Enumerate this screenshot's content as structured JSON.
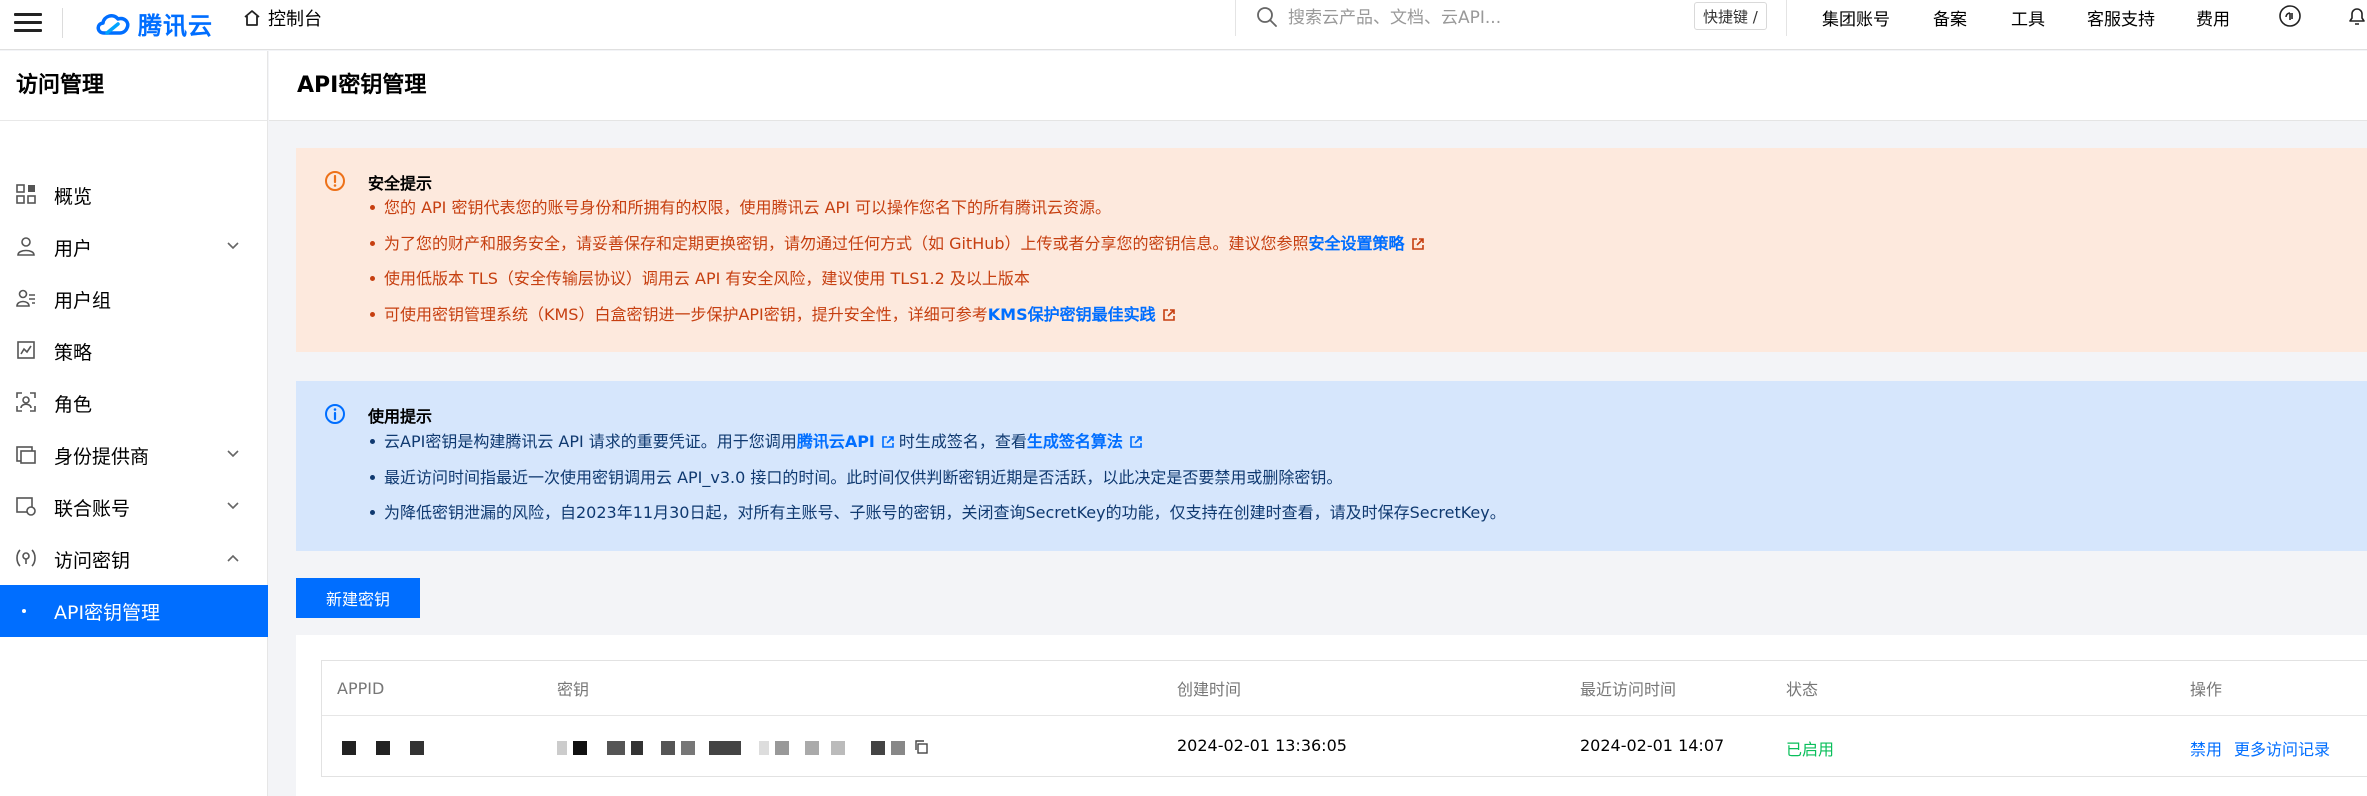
{
  "topbar": {
    "brand": "腾讯云",
    "console": "控制台",
    "search_placeholder": "搜索云产品、文档、云API...",
    "shortcut": "快捷键 /",
    "nav": [
      "集团账号",
      "备案",
      "工具",
      "客服支持",
      "费用"
    ]
  },
  "sidebar": {
    "title": "访问管理",
    "items": [
      {
        "label": "概览",
        "icon": "overview-icon"
      },
      {
        "label": "用户",
        "icon": "user-icon"
      },
      {
        "label": "用户组",
        "icon": "user-group-icon"
      },
      {
        "label": "策略",
        "icon": "policy-icon"
      },
      {
        "label": "角色",
        "icon": "role-icon"
      },
      {
        "label": "身份提供商",
        "icon": "identity-provider-icon"
      },
      {
        "label": "联合账号",
        "icon": "federated-account-icon"
      },
      {
        "label": "访问密钥",
        "icon": "access-key-icon"
      },
      {
        "label": "API密钥管理",
        "icon": "dot"
      }
    ]
  },
  "main": {
    "title": "API密钥管理",
    "security_notice": {
      "title": "安全提示",
      "lines": [
        "您的 API 密钥代表您的账号身份和所拥有的权限，使用腾讯云 API 可以操作您名下的所有腾讯云资源。",
        "为了您的财产和服务安全，请妥善保存和定期更换密钥，请勿通过任何方式（如 GitHub）上传或者分享您的密钥信息。建议您参照",
        "使用低版本 TLS（安全传输层协议）调用云 API 有安全风险，建议使用 TLS1.2 及以上版本",
        "可使用密钥管理系统（KMS）白盒密钥进一步保护API密钥，提升安全性，详细可参考"
      ],
      "link_security_policy": "安全设置策略",
      "link_kms": "KMS保护密钥最佳实践"
    },
    "usage_notice": {
      "title": "使用提示",
      "line1_a": "云API密钥是构建腾讯云 API 请求的重要凭证。用于您调用",
      "line1_link1": "腾讯云API",
      "line1_b": "时生成签名，查看",
      "line1_link2": "生成签名算法",
      "line2": "最近访问时间指最近一次使用密钥调用云 API_v3.0 接口的时间。此时间仅供判断密钥近期是否活跃，以此决定是否要禁用或删除密钥。",
      "line3": "为降低密钥泄漏的风险，自2023年11月30日起，对所有主账号、子账号的密钥，关闭查询SecretKey的功能，仅支持在创建时查看，请及时保存SecretKey。"
    },
    "create_button": "新建密钥",
    "table": {
      "columns": [
        "APPID",
        "密钥",
        "创建时间",
        "最近访问时间",
        "状态",
        "操作"
      ],
      "rows": [
        {
          "created": "2024-02-01 13:36:05",
          "last_access": "2024-02-01 14:07",
          "status": "已启用",
          "actions": [
            "禁用",
            "更多访问记录"
          ]
        }
      ]
    }
  },
  "colors": {
    "accent": "#006eff",
    "warning_bg": "#fde9dd",
    "warning_text": "#c63f10",
    "info_bg": "#d6e6fc",
    "info_text": "#0f3970",
    "status_enabled": "#0abf5b"
  }
}
